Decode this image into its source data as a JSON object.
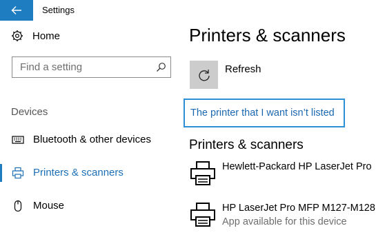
{
  "window": {
    "title": "Settings"
  },
  "sidebar": {
    "home_label": "Home",
    "search": {
      "placeholder": "Find a setting"
    },
    "section_label": "Devices",
    "items": [
      {
        "label": "Bluetooth & other devices",
        "icon": "keyboard-icon"
      },
      {
        "label": "Printers & scanners",
        "icon": "printer-icon",
        "active": true
      },
      {
        "label": "Mouse",
        "icon": "mouse-icon"
      }
    ]
  },
  "main": {
    "title": "Printers & scanners",
    "refresh_label": "Refresh",
    "add_link_label": "The printer that I want isn’t listed",
    "section_heading": "Printers & scanners",
    "printers": [
      {
        "name": "Hewlett-Packard HP LaserJet Pro",
        "status": ""
      },
      {
        "name": "HP LaserJet Pro MFP M127-M128",
        "status": "App available for this device"
      }
    ]
  },
  "colors": {
    "accent": "#1e7dc1",
    "link": "#1a67b0",
    "focus_border": "#2b8fd6",
    "tile": "#cccccc"
  }
}
